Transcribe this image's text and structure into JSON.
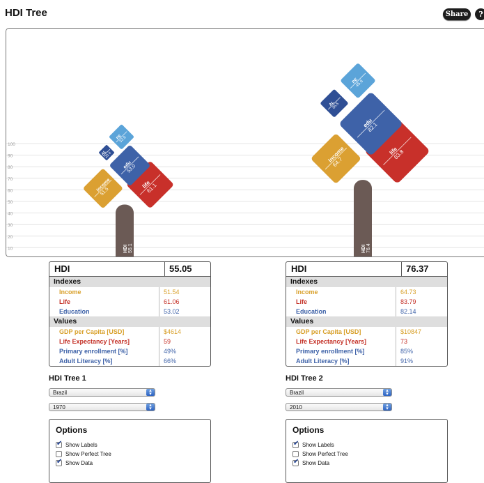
{
  "app": {
    "title": "HDI Tree",
    "share_label": "Share",
    "help_label": "?"
  },
  "chart_data": {
    "type": "other",
    "y_ticks": [
      "100",
      "90",
      "80",
      "70",
      "60",
      "50",
      "40",
      "30",
      "20",
      "10"
    ],
    "ylim": [
      0,
      100
    ],
    "trees": [
      {
        "hdi": 55.1,
        "income": 51.5,
        "life": 61.1,
        "edu": 53.0,
        "al": 20.4,
        "pe": 32.6
      },
      {
        "hdi": 76.4,
        "income": 64.7,
        "life": 83.8,
        "edu": 82.1,
        "al": 36.5,
        "pe": 45.6
      }
    ],
    "labels": {
      "hdi": "HDI",
      "income": "income",
      "life": "life",
      "edu": "edu",
      "al": "AL",
      "pe": "PE"
    },
    "colors": {
      "income": "#dba032",
      "life": "#c8302a",
      "edu": "#3e62a8",
      "al": "#2f4f95",
      "pe": "#5ba4d9",
      "trunk": "#6b5a55"
    }
  },
  "table1": {
    "hdi_label": "HDI",
    "hdi_value": "55.05",
    "indexes_label": "Indexes",
    "indexes": [
      {
        "label": "Income",
        "value": "51.54",
        "cls": "c-inc"
      },
      {
        "label": "Life",
        "value": "61.06",
        "cls": "c-life"
      },
      {
        "label": "Education",
        "value": "53.02",
        "cls": "c-edu"
      }
    ],
    "values_label": "Values",
    "values": [
      {
        "label": "GDP per Capita [USD]",
        "value": "$4614",
        "cls": "c-inc"
      },
      {
        "label": "Life Expectancy [Years]",
        "value": "59",
        "cls": "c-life"
      },
      {
        "label": "Primary enrollment [%]",
        "value": "49%",
        "cls": "c-edu"
      },
      {
        "label": "Adult Literacy [%]",
        "value": "66%",
        "cls": "c-edu"
      }
    ]
  },
  "table2": {
    "hdi_label": "HDI",
    "hdi_value": "76.37",
    "indexes_label": "Indexes",
    "indexes": [
      {
        "label": "Income",
        "value": "64.73",
        "cls": "c-inc"
      },
      {
        "label": "Life",
        "value": "83.79",
        "cls": "c-life"
      },
      {
        "label": "Education",
        "value": "82.14",
        "cls": "c-edu"
      }
    ],
    "values_label": "Values",
    "values": [
      {
        "label": "GDP per Capita [USD]",
        "value": "$10847",
        "cls": "c-inc"
      },
      {
        "label": "Life Expectancy [Years]",
        "value": "73",
        "cls": "c-life"
      },
      {
        "label": "Primary enrollment [%]",
        "value": "85%",
        "cls": "c-edu"
      },
      {
        "label": "Adult Literacy [%]",
        "value": "91%",
        "cls": "c-edu"
      }
    ]
  },
  "tree1": {
    "heading": "HDI Tree 1",
    "country": "Brazil",
    "year": "1970"
  },
  "tree2": {
    "heading": "HDI Tree 2",
    "country": "Brazil",
    "year": "2010"
  },
  "options": {
    "title": "Options",
    "items": [
      {
        "label": "Show Labels",
        "checked": true
      },
      {
        "label": "Show Perfect Tree",
        "checked": false
      },
      {
        "label": "Show Data",
        "checked": true
      }
    ]
  }
}
